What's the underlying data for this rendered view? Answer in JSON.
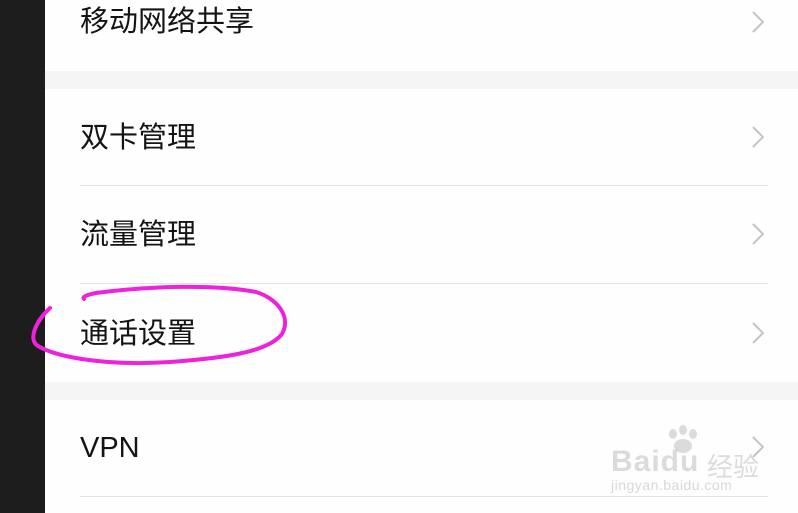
{
  "settings": {
    "items": [
      {
        "label": "移动网络共享"
      },
      {
        "label": "双卡管理"
      },
      {
        "label": "流量管理"
      },
      {
        "label": "通话设置"
      },
      {
        "label": "VPN"
      }
    ]
  },
  "annotation": {
    "color": "#ee22dd",
    "target": "通话设置"
  },
  "watermark": {
    "brand": "Baidu",
    "cn": "经验",
    "url": "jingyan.baidu.com"
  },
  "colors": {
    "background": "#f5f5f5",
    "card": "#fefefe",
    "text": "#141414",
    "chevron": "#c4c4c4",
    "divider": "#e3e3e3",
    "left_bar": "#1d1d1d"
  }
}
